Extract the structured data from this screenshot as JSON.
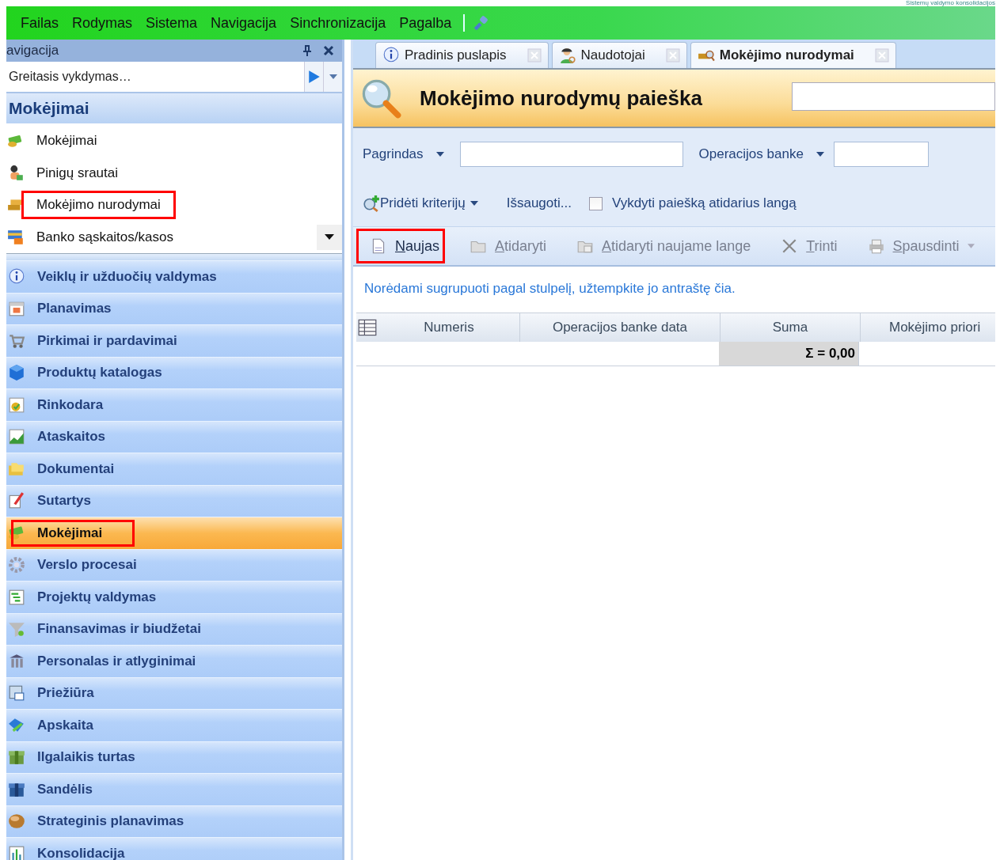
{
  "top_caption": "Sistemų valdymo konsolidacijos",
  "menu": [
    {
      "label": "Failas"
    },
    {
      "label": "Rodymas"
    },
    {
      "label": "Sistema"
    },
    {
      "label": "Navigacija"
    },
    {
      "label": "Sinchronizacija"
    },
    {
      "label": "Pagalba"
    }
  ],
  "navigation": {
    "title": "avigacija",
    "quick_run": {
      "placeholder": "Greitasis vykdymas…"
    },
    "group_title": "Mokėjimai",
    "group_items": [
      {
        "label": "Mokėjimai",
        "highlighted": false
      },
      {
        "label": "Pinigų srautai",
        "highlighted": false
      },
      {
        "label": "Mokėjimo nurodymai",
        "highlighted": true
      },
      {
        "label": "Banko sąskaitos/kasos",
        "highlighted": false
      }
    ],
    "sections": [
      {
        "label": "Veiklų ir užduočių valdymas",
        "selected": false,
        "highlighted": false
      },
      {
        "label": "Planavimas",
        "selected": false,
        "highlighted": false
      },
      {
        "label": "Pirkimai ir pardavimai",
        "selected": false,
        "highlighted": false
      },
      {
        "label": "Produktų katalogas",
        "selected": false,
        "highlighted": false
      },
      {
        "label": "Rinkodara",
        "selected": false,
        "highlighted": false
      },
      {
        "label": "Ataskaitos",
        "selected": false,
        "highlighted": false
      },
      {
        "label": "Dokumentai",
        "selected": false,
        "highlighted": false
      },
      {
        "label": "Sutartys",
        "selected": false,
        "highlighted": false
      },
      {
        "label": "Mokėjimai",
        "selected": true,
        "highlighted": true
      },
      {
        "label": "Verslo procesai",
        "selected": false,
        "highlighted": false
      },
      {
        "label": "Projektų valdymas",
        "selected": false,
        "highlighted": false
      },
      {
        "label": "Finansavimas ir biudžetai",
        "selected": false,
        "highlighted": false
      },
      {
        "label": "Personalas ir atlyginimai",
        "selected": false,
        "highlighted": false
      },
      {
        "label": "Priežiūra",
        "selected": false,
        "highlighted": false
      },
      {
        "label": "Apskaita",
        "selected": false,
        "highlighted": false
      },
      {
        "label": "Ilgalaikis turtas",
        "selected": false,
        "highlighted": false
      },
      {
        "label": "Sandėlis",
        "selected": false,
        "highlighted": false
      },
      {
        "label": "Strateginis planavimas",
        "selected": false,
        "highlighted": false
      },
      {
        "label": "Konsolidacija",
        "selected": false,
        "highlighted": false
      }
    ]
  },
  "tabs": [
    {
      "label": "Pradinis puslapis",
      "selected": false
    },
    {
      "label": "Naudotojai",
      "selected": false
    },
    {
      "label": "Mokėjimo nurodymai",
      "selected": true
    }
  ],
  "search": {
    "title": "Mokėjimo nurodymų paieška",
    "criteria": [
      {
        "label": "Pagrindas"
      },
      {
        "label": "Operacijos banke"
      }
    ],
    "add_criteria": "Pridėti kriterijų",
    "save": "Išsaugoti...",
    "run_on_open": {
      "label": "Vykdyti paiešką atidarius langą",
      "checked": false
    }
  },
  "toolbar": [
    {
      "label": "Naujas",
      "disabled": false,
      "highlighted": true
    },
    {
      "label": "Atidaryti",
      "disabled": true,
      "highlighted": false
    },
    {
      "label": "Atidaryti naujame lange",
      "disabled": true,
      "highlighted": false
    },
    {
      "label": "Trinti",
      "disabled": true,
      "highlighted": false
    },
    {
      "label": "Spausdinti",
      "disabled": true,
      "highlighted": false
    }
  ],
  "group_hint": "Norėdami sugrupuoti pagal stulpelį, užtempkite jo antraštę čia.",
  "grid": {
    "columns": [
      "Numeris",
      "Operacijos banke data",
      "Suma",
      "Mokėjimo priori"
    ],
    "sum_text": "Σ = 0,00"
  }
}
